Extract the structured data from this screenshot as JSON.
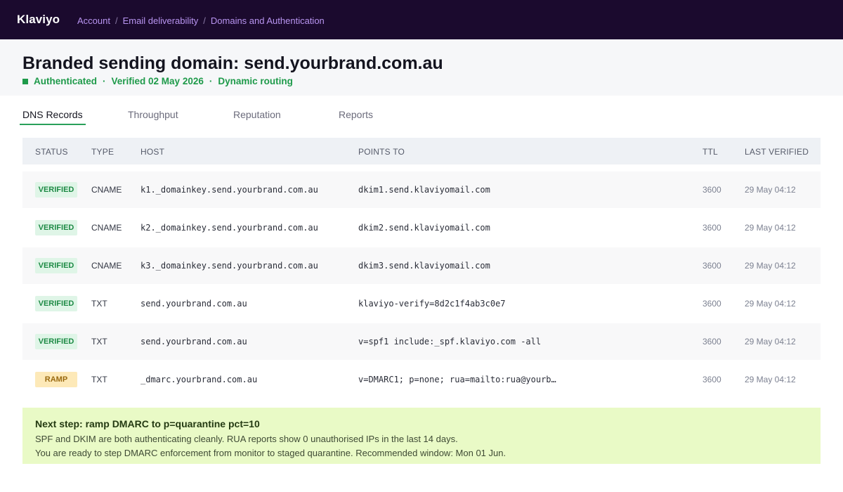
{
  "topbar": {
    "brand": "Klaviyo",
    "breadcrumbs": [
      "Account",
      "Email deliverability",
      "Domains and Authentication"
    ],
    "separator": "/"
  },
  "header": {
    "title": "Branded sending domain: send.yourbrand.com.au",
    "status": "Authenticated",
    "verified": "Verified 02 May 2026",
    "routing": "Dynamic routing",
    "separator": "·"
  },
  "tabs": [
    "DNS Records",
    "Throughput",
    "Reputation",
    "Reports"
  ],
  "table": {
    "columns": [
      "STATUS",
      "TYPE",
      "HOST",
      "POINTS TO",
      "TTL",
      "LAST VERIFIED"
    ],
    "rows": [
      {
        "status": "VERIFIED",
        "type": "CNAME",
        "host": "k1._domainkey.send.yourbrand.com.au",
        "points_to": "dkim1.send.klaviyomail.com",
        "ttl": "3600",
        "last_verified": "29 May 04:12"
      },
      {
        "status": "VERIFIED",
        "type": "CNAME",
        "host": "k2._domainkey.send.yourbrand.com.au",
        "points_to": "dkim2.send.klaviyomail.com",
        "ttl": "3600",
        "last_verified": "29 May 04:12"
      },
      {
        "status": "VERIFIED",
        "type": "CNAME",
        "host": "k3._domainkey.send.yourbrand.com.au",
        "points_to": "dkim3.send.klaviyomail.com",
        "ttl": "3600",
        "last_verified": "29 May 04:12"
      },
      {
        "status": "VERIFIED",
        "type": "TXT",
        "host": "send.yourbrand.com.au",
        "points_to": "klaviyo-verify=8d2c1f4ab3c0e7",
        "ttl": "3600",
        "last_verified": "29 May 04:12"
      },
      {
        "status": "VERIFIED",
        "type": "TXT",
        "host": "send.yourbrand.com.au",
        "points_to": "v=spf1 include:_spf.klaviyo.com -all",
        "ttl": "3600",
        "last_verified": "29 May 04:12"
      },
      {
        "status": "RAMP",
        "type": "TXT",
        "host": "_dmarc.yourbrand.com.au",
        "points_to": "v=DMARC1; p=none; rua=mailto:rua@yourb…",
        "ttl": "3600",
        "last_verified": "29 May 04:12"
      }
    ]
  },
  "callout": {
    "title": "Next step: ramp DMARC to p=quarantine pct=10",
    "line1": "SPF and DKIM are both authenticating cleanly. RUA reports show 0 unauthorised IPs in the last 14 days.",
    "line2": "You are ready to step DMARC enforcement from monitor to staged quarantine. Recommended window: Mon 01 Jun."
  },
  "colors": {
    "topbar": "#1b0a2e",
    "accent_green": "#1e9a4a",
    "verified_badge_bg": "#dff5e7",
    "ramp_badge_bg": "#fde9b8",
    "callout_bg": "#e9fac6"
  }
}
